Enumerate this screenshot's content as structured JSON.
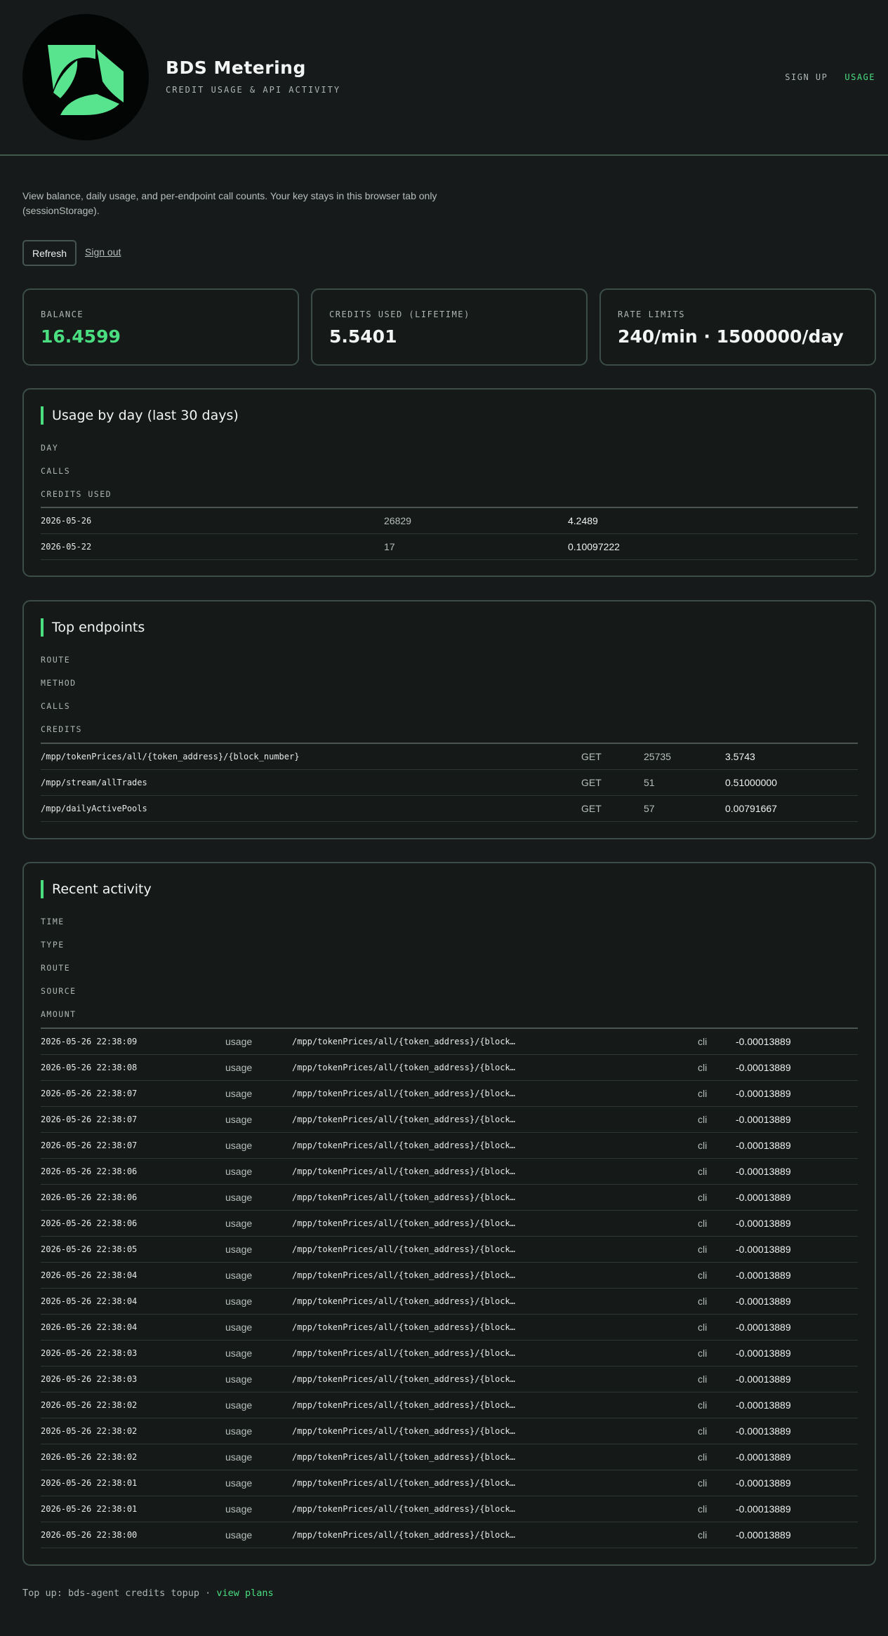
{
  "app": {
    "title": "BDS Metering",
    "subtitle": "CREDIT USAGE & API ACTIVITY",
    "accent_color": "#4ade80",
    "logo_icon": "green-four-petal-logo"
  },
  "nav": {
    "sign_up": "SIGN UP",
    "usage": "USAGE"
  },
  "intro": {
    "text": "View balance, daily usage, and per-endpoint call counts. Your key stays in this browser tab only (sessionStorage)."
  },
  "actions": {
    "refresh": "Refresh",
    "sign_out": "Sign out"
  },
  "stats": {
    "balance_label": "BALANCE",
    "balance_value": "16.4599",
    "credits_used_label": "CREDITS USED (LIFETIME)",
    "credits_used_value": "5.5401",
    "rate_limits_label": "RATE LIMITS",
    "rate_limits_value": "240/min · 1500000/day"
  },
  "usage_by_day": {
    "title": "Usage by day (last 30 days)",
    "columns": [
      "DAY",
      "CALLS",
      "CREDITS USED"
    ],
    "rows": [
      {
        "day": "2026-05-26",
        "calls": "26829",
        "credits": "4.2489"
      },
      {
        "day": "2026-05-22",
        "calls": "17",
        "credits": "0.10097222"
      }
    ]
  },
  "top_endpoints": {
    "title": "Top endpoints",
    "columns": [
      "ROUTE",
      "METHOD",
      "CALLS",
      "CREDITS"
    ],
    "rows": [
      {
        "route": "/mpp/tokenPrices/all/{token_address}/{block_number}",
        "method": "GET",
        "calls": "25735",
        "credits": "3.5743"
      },
      {
        "route": "/mpp/stream/allTrades",
        "method": "GET",
        "calls": "51",
        "credits": "0.51000000"
      },
      {
        "route": "/mpp/dailyActivePools",
        "method": "GET",
        "calls": "57",
        "credits": "0.00791667"
      }
    ]
  },
  "recent_activity": {
    "title": "Recent activity",
    "columns": [
      "TIME",
      "TYPE",
      "ROUTE",
      "SOURCE",
      "AMOUNT"
    ],
    "rows": [
      {
        "time": "2026-05-26 22:38:09",
        "type": "usage",
        "route": "/mpp/tokenPrices/all/{token_address}/{block…",
        "source": "cli",
        "amount": "-0.00013889"
      },
      {
        "time": "2026-05-26 22:38:08",
        "type": "usage",
        "route": "/mpp/tokenPrices/all/{token_address}/{block…",
        "source": "cli",
        "amount": "-0.00013889"
      },
      {
        "time": "2026-05-26 22:38:07",
        "type": "usage",
        "route": "/mpp/tokenPrices/all/{token_address}/{block…",
        "source": "cli",
        "amount": "-0.00013889"
      },
      {
        "time": "2026-05-26 22:38:07",
        "type": "usage",
        "route": "/mpp/tokenPrices/all/{token_address}/{block…",
        "source": "cli",
        "amount": "-0.00013889"
      },
      {
        "time": "2026-05-26 22:38:07",
        "type": "usage",
        "route": "/mpp/tokenPrices/all/{token_address}/{block…",
        "source": "cli",
        "amount": "-0.00013889"
      },
      {
        "time": "2026-05-26 22:38:06",
        "type": "usage",
        "route": "/mpp/tokenPrices/all/{token_address}/{block…",
        "source": "cli",
        "amount": "-0.00013889"
      },
      {
        "time": "2026-05-26 22:38:06",
        "type": "usage",
        "route": "/mpp/tokenPrices/all/{token_address}/{block…",
        "source": "cli",
        "amount": "-0.00013889"
      },
      {
        "time": "2026-05-26 22:38:06",
        "type": "usage",
        "route": "/mpp/tokenPrices/all/{token_address}/{block…",
        "source": "cli",
        "amount": "-0.00013889"
      },
      {
        "time": "2026-05-26 22:38:05",
        "type": "usage",
        "route": "/mpp/tokenPrices/all/{token_address}/{block…",
        "source": "cli",
        "amount": "-0.00013889"
      },
      {
        "time": "2026-05-26 22:38:04",
        "type": "usage",
        "route": "/mpp/tokenPrices/all/{token_address}/{block…",
        "source": "cli",
        "amount": "-0.00013889"
      },
      {
        "time": "2026-05-26 22:38:04",
        "type": "usage",
        "route": "/mpp/tokenPrices/all/{token_address}/{block…",
        "source": "cli",
        "amount": "-0.00013889"
      },
      {
        "time": "2026-05-26 22:38:04",
        "type": "usage",
        "route": "/mpp/tokenPrices/all/{token_address}/{block…",
        "source": "cli",
        "amount": "-0.00013889"
      },
      {
        "time": "2026-05-26 22:38:03",
        "type": "usage",
        "route": "/mpp/tokenPrices/all/{token_address}/{block…",
        "source": "cli",
        "amount": "-0.00013889"
      },
      {
        "time": "2026-05-26 22:38:03",
        "type": "usage",
        "route": "/mpp/tokenPrices/all/{token_address}/{block…",
        "source": "cli",
        "amount": "-0.00013889"
      },
      {
        "time": "2026-05-26 22:38:02",
        "type": "usage",
        "route": "/mpp/tokenPrices/all/{token_address}/{block…",
        "source": "cli",
        "amount": "-0.00013889"
      },
      {
        "time": "2026-05-26 22:38:02",
        "type": "usage",
        "route": "/mpp/tokenPrices/all/{token_address}/{block…",
        "source": "cli",
        "amount": "-0.00013889"
      },
      {
        "time": "2026-05-26 22:38:02",
        "type": "usage",
        "route": "/mpp/tokenPrices/all/{token_address}/{block…",
        "source": "cli",
        "amount": "-0.00013889"
      },
      {
        "time": "2026-05-26 22:38:01",
        "type": "usage",
        "route": "/mpp/tokenPrices/all/{token_address}/{block…",
        "source": "cli",
        "amount": "-0.00013889"
      },
      {
        "time": "2026-05-26 22:38:01",
        "type": "usage",
        "route": "/mpp/tokenPrices/all/{token_address}/{block…",
        "source": "cli",
        "amount": "-0.00013889"
      },
      {
        "time": "2026-05-26 22:38:00",
        "type": "usage",
        "route": "/mpp/tokenPrices/all/{token_address}/{block…",
        "source": "cli",
        "amount": "-0.00013889"
      }
    ]
  },
  "footer": {
    "text": "Top up: bds-agent credits topup · ",
    "link": "view plans"
  }
}
